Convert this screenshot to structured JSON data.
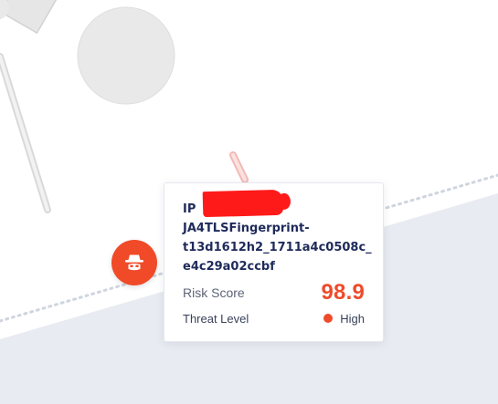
{
  "tooltip": {
    "title_lines": [
      "IP",
      "JA4TLSFingerprint-",
      "t13d1612h2_1711a4c0508c_",
      "e4c29a02ccbf"
    ],
    "risk_score_label": "Risk Score",
    "risk_score_value": "98.9",
    "threat_level_label": "Threat Level",
    "threat_level_value": "High"
  },
  "node": {
    "icon": "spy-icon"
  },
  "colors": {
    "accent": "#EE4B2B",
    "title": "#1E2A5A",
    "label": "#5D6478",
    "lower_region": "#E8EBF1",
    "shapes": "#E9E9E9"
  }
}
